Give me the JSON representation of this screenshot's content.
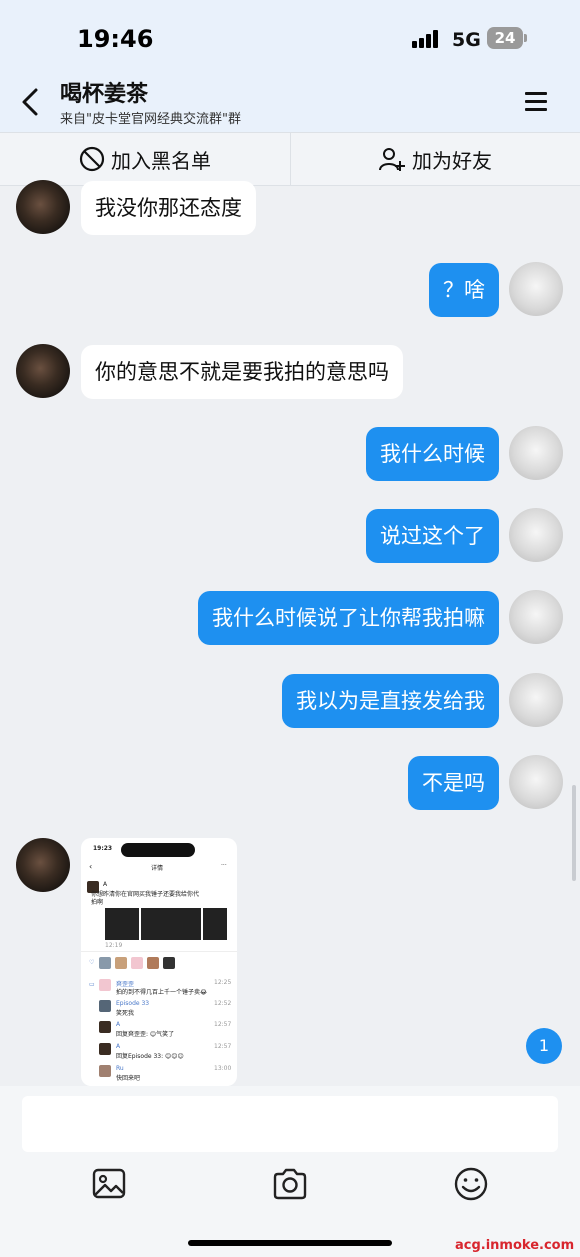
{
  "status": {
    "time": "19:46",
    "network": "5G",
    "battery": "24"
  },
  "header": {
    "title": "喝杯姜茶",
    "subtitle": "来自\"皮卡堂官网经典交流群\"群"
  },
  "actions": {
    "block": "加入黑名单",
    "add_friend": "加为好友"
  },
  "messages": [
    {
      "side": "in",
      "text": "我没你那还态度"
    },
    {
      "side": "out",
      "text": "？啥"
    },
    {
      "side": "in",
      "text": "你的意思不就是要我拍的意思吗"
    },
    {
      "side": "out",
      "text": "我什么时候"
    },
    {
      "side": "out",
      "text": "说过这个了"
    },
    {
      "side": "out",
      "text": "我什么时候说了让你帮我拍嘛"
    },
    {
      "side": "out",
      "text": "我以为是直接发给我"
    },
    {
      "side": "out",
      "text": "不是吗"
    }
  ],
  "image_message": {
    "time": "19:23",
    "page_title": "详情",
    "poster": "A",
    "post_text_1": "你想昨清你在官网买我锤子还要我给你代",
    "post_text_2": "拍啊",
    "post_time": "12:19",
    "comments": [
      {
        "name": "爽歪歪",
        "text": "拍的到不得几百上千一个锤子卖😂",
        "time": "12:25"
      },
      {
        "name": "Episode 33",
        "text": "笑死我",
        "time": "12:52"
      },
      {
        "name": "A",
        "text": "回复爽歪歪: 😊气笑了",
        "time": "12:57"
      },
      {
        "name": "A",
        "text": "回复Episode 33: 😊😊😊",
        "time": "12:57"
      },
      {
        "name": "Ru",
        "text": "快回来吧",
        "time": "13:00"
      }
    ]
  },
  "unread_badge": "1",
  "icons": [
    "back-chevron-icon",
    "menu-icon",
    "block-icon",
    "add-friend-icon",
    "image-icon",
    "camera-icon",
    "emoji-icon"
  ],
  "colors": {
    "accent": "#1e90f0",
    "header_bg": "#e9f1fb",
    "chat_bg": "#eef0f3"
  },
  "watermark": "acg.inmoke.com"
}
